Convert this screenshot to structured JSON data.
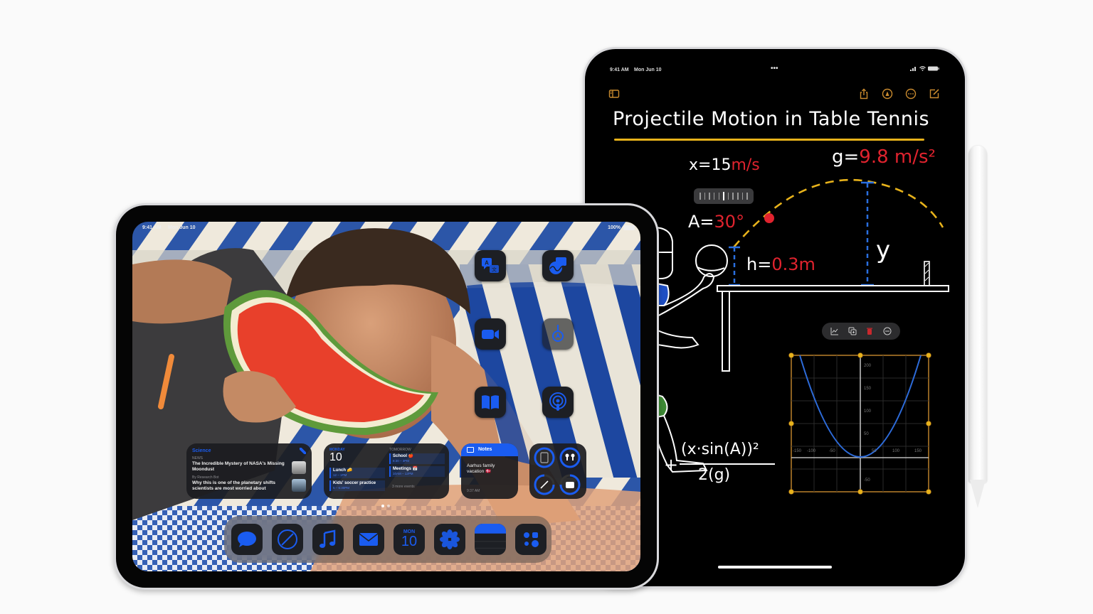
{
  "notes_ipad": {
    "status_bar": {
      "time": "9:41 AM",
      "date": "Mon Jun 10",
      "multitask_dots": "•••"
    },
    "toolbar": {
      "sidebar_icon": "sidebar-icon",
      "share_icon": "share-icon",
      "markup_icon": "markup-pen-icon",
      "more_icon": "ellipsis-circle-icon",
      "compose_icon": "compose-icon"
    },
    "note": {
      "title": "Projectile Motion in Table Tennis",
      "x_label": "x=",
      "x_value": "15",
      "x_unit": "m/s",
      "g_label": "g=",
      "g_value": "9.8 m/s²",
      "a_label": "A=",
      "a_value": "30°",
      "h_label": "h=",
      "h_value": "0.3m",
      "y_label": "y",
      "formula_prefix": "+",
      "formula_numerator": "(x·sin(A))²",
      "formula_denominator": "2(g)"
    },
    "graph_toolbar": [
      "graph-icon",
      "duplicate-icon",
      "trash-icon",
      "minus-circle-icon"
    ],
    "graph": {
      "x_ticks": [
        "-150",
        "-100",
        "-50",
        "50",
        "100",
        "150"
      ],
      "y_ticks": [
        "200",
        "150",
        "100",
        "50",
        "-50"
      ],
      "accent_color": "#c98a2e",
      "curve_color": "#2d6bd9"
    },
    "colors": {
      "highlight": "#e7b21b",
      "red": "#e0232e",
      "blue": "#2a6fe0"
    }
  },
  "home_ipad": {
    "status_bar": {
      "time": "9:41 AM",
      "date": "Mon Jun 10",
      "battery": "100%"
    },
    "app_grid": [
      {
        "name": "Translate",
        "icon": "translate-icon"
      },
      {
        "name": "Freeform",
        "icon": "freeform-icon"
      },
      {
        "name": "FaceTime",
        "icon": "video-camera-icon"
      },
      {
        "name": "Find My",
        "icon": "location-arrow-icon"
      },
      {
        "name": "Books",
        "icon": "book-icon"
      },
      {
        "name": "Podcasts",
        "icon": "podcast-icon"
      }
    ],
    "news_widget": {
      "section": "Science",
      "source1": "NEWS",
      "headline1": "The Incredible Mystery of NASA's Missing Moondust",
      "source2": "By Research Bot",
      "headline2": "Why this is one of the planetary shifts scientists are most worried about"
    },
    "calendar_widget": {
      "today_label": "MONDAY",
      "today_date": "10",
      "tomorrow_label": "TOMORROW",
      "events_today": [
        {
          "title": "Lunch 🧀",
          "time": "12 – 1PM"
        },
        {
          "title": "Kids' soccer practice",
          "time": "5 – 6:30PM"
        }
      ],
      "events_tomorrow": [
        {
          "title": "School 🍎",
          "time": "8:30 – 3PM"
        },
        {
          "title": "Meetings 📅",
          "time": "10AM – 12PM"
        }
      ],
      "more_events": "3 more events"
    },
    "notes_widget": {
      "header": "Notes",
      "note_title": "Aarhus family vacation 🇩🇰",
      "time": "9:37 AM"
    },
    "batteries_widget": [
      "ipad-battery",
      "airpods-battery",
      "pencil-battery",
      "case-battery"
    ],
    "page_dots": {
      "count": 2,
      "active": 0
    },
    "dock": [
      {
        "name": "Messages",
        "icon": "message-bubble-icon"
      },
      {
        "name": "Safari",
        "icon": "compass-icon"
      },
      {
        "name": "Music",
        "icon": "music-note-icon"
      },
      {
        "name": "Mail",
        "icon": "envelope-icon"
      },
      {
        "name": "Calendar",
        "icon": "calendar-icon",
        "day": "MON",
        "date": "10"
      },
      {
        "name": "Photos",
        "icon": "photos-flower-icon"
      },
      {
        "name": "Notes",
        "icon": "notes-icon"
      },
      {
        "name": "App Library",
        "icon": "app-library-icon"
      }
    ],
    "colors": {
      "tint": "#1a5cf0"
    }
  }
}
